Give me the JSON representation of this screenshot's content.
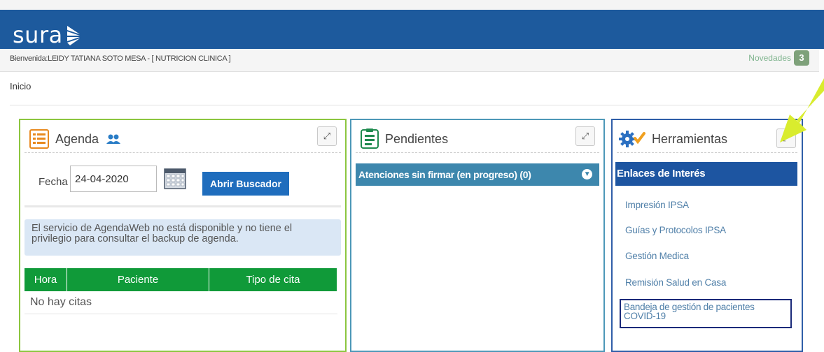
{
  "header": {
    "logo_text": "sura",
    "brand_color": "#1d5a9d"
  },
  "subbar": {
    "welcome": "Bienvenida:LEIDY TATIANA SOTO MESA - [ NUTRICION CLINICA ]",
    "novedades_label": "Novedades",
    "novedades_count": "3"
  },
  "breadcrumb": "Inicio",
  "agenda": {
    "title": "Agenda",
    "fecha_label": "Fecha",
    "fecha_value": "24-04-2020",
    "buscar_button": "Abrir Buscador",
    "info_message": "El servicio de AgendaWeb no está disponible y no tiene el privilegio para consultar el backup de agenda.",
    "table": {
      "headers": [
        "Hora",
        "Paciente",
        "Tipo de cita"
      ],
      "empty": "No hay citas"
    }
  },
  "pendientes": {
    "title": "Pendientes",
    "accordion": "Atenciones sin firmar (en progreso) (0)"
  },
  "herramientas": {
    "title": "Herramientas",
    "section": "Enlaces de Interés",
    "links": [
      "Impresión IPSA",
      "Guías y Protocolos IPSA",
      "Gestión Medica",
      "Remisión Salud en Casa",
      "Bandeja de gestión de pacientes COVID-19"
    ]
  },
  "icons": [
    "agenda-list-icon",
    "users-icon",
    "calendar-icon",
    "pendientes-icon",
    "gears-check-icon",
    "expand-icon",
    "chevron-down-circle-icon",
    "highlight-arrow"
  ],
  "colors": {
    "agenda_border": "#8cc63f",
    "pendientes_border": "#4d98b8",
    "herramientas_border": "#2f5ea8",
    "table_header": "#109a39",
    "button": "#1f6dbd",
    "arrow": "#d9ec2e"
  }
}
